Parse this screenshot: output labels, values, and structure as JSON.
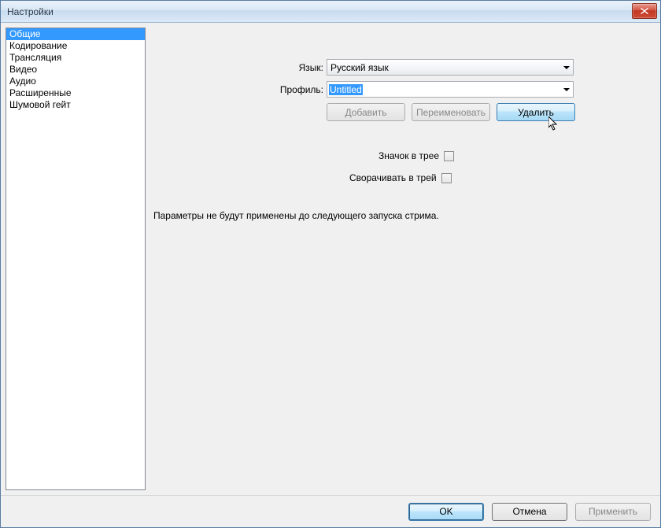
{
  "window": {
    "title": "Настройки"
  },
  "sidebar": {
    "items": [
      {
        "label": "Общие",
        "selected": true
      },
      {
        "label": "Кодирование"
      },
      {
        "label": "Трансляция"
      },
      {
        "label": "Видео"
      },
      {
        "label": "Аудио"
      },
      {
        "label": "Расширенные"
      },
      {
        "label": "Шумовой гейт"
      }
    ]
  },
  "main": {
    "language_label": "Язык:",
    "language_value": "Русский язык",
    "profile_label": "Профиль:",
    "profile_value": "Untitled",
    "add_label": "Добавить",
    "rename_label": "Переименовать",
    "delete_label": "Удалить",
    "tray_icon_label": "Значок в трее",
    "minimize_tray_label": "Сворачивать в трей",
    "note": "Параметры не будут применены до следующего запуска стрима."
  },
  "buttons": {
    "ok": "OK",
    "cancel": "Отмена",
    "apply": "Применить"
  }
}
